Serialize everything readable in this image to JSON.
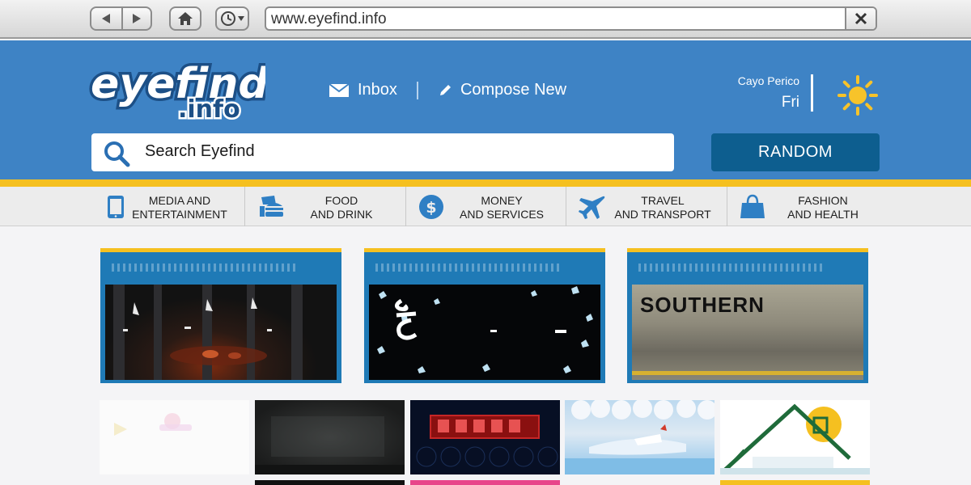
{
  "browser": {
    "url": "www.eyefind.info",
    "back_icon": "back-arrow-icon",
    "forward_icon": "forward-arrow-icon",
    "home_icon": "home-icon",
    "history_icon": "clock-icon",
    "close_icon": "close-icon"
  },
  "header": {
    "logo_text_main": "eyefind",
    "logo_text_sub": ".info",
    "inbox_label": "Inbox",
    "compose_label": "Compose New",
    "weather_location": "Cayo Perico",
    "weather_day": "Fri",
    "weather_icon": "sun-icon"
  },
  "search": {
    "placeholder": "Search Eyefind",
    "random_label": "RANDOM"
  },
  "categories": [
    {
      "line1": "MEDIA AND",
      "line2": "ENTERTAINMENT",
      "icon": "tablet-icon"
    },
    {
      "line1": "FOOD",
      "line2": "AND DRINK",
      "icon": "burger-icon"
    },
    {
      "line1": "MONEY",
      "line2": "AND SERVICES",
      "icon": "dollar-icon"
    },
    {
      "line1": "TRAVEL",
      "line2": "AND TRANSPORT",
      "icon": "airplane-icon"
    },
    {
      "line1": "FASHION",
      "line2": "AND HEALTH",
      "icon": "shopping-bag-icon"
    }
  ],
  "featured": [
    {
      "image_text": ""
    },
    {
      "image_text": ""
    },
    {
      "image_text": "SOUTHERN"
    }
  ],
  "colors": {
    "header_blue": "#3e83c5",
    "accent_yellow": "#f5c020",
    "button_blue": "#0d5e8f",
    "card_blue": "#1f7ab6"
  }
}
